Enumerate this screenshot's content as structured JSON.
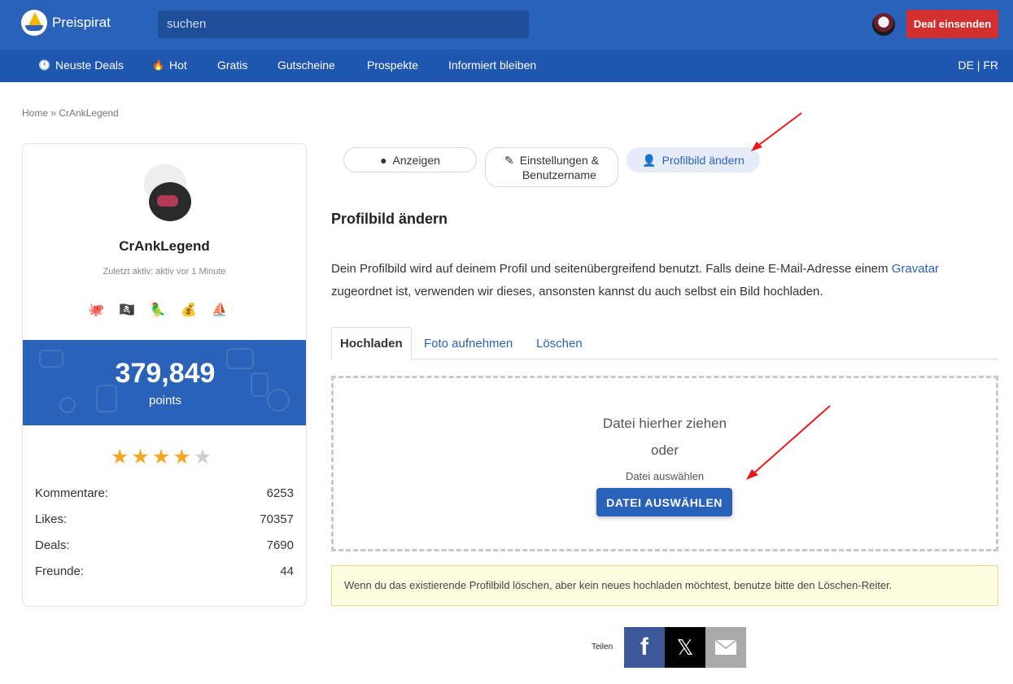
{
  "header": {
    "brand": "Preispirat",
    "search_placeholder": "suchen",
    "deal_button": "Deal einsenden"
  },
  "nav": {
    "items": [
      {
        "label": "Neuste Deals",
        "icon": "clock-icon"
      },
      {
        "label": "Hot",
        "icon": "flame-icon"
      },
      {
        "label": "Gratis"
      },
      {
        "label": "Gutscheine"
      },
      {
        "label": "Prospekte"
      },
      {
        "label": "Informiert bleiben"
      }
    ],
    "lang": "DE | FR"
  },
  "breadcrumb": "Home » CrAnkLegend",
  "profile": {
    "username": "CrAnkLegend",
    "last_active": "Zuletzt aktiv: aktiv vor 1 Minute",
    "points": "379,849",
    "points_label": "points",
    "rating": 4,
    "rating_max": 5,
    "stats": [
      {
        "label": "Kommentare:",
        "value": "6253"
      },
      {
        "label": "Likes:",
        "value": "70357"
      },
      {
        "label": "Deals:",
        "value": "7690"
      },
      {
        "label": "Freunde:",
        "value": "44"
      }
    ]
  },
  "profile_tabs": {
    "show": "Anzeigen",
    "settings_line1": "Einstellungen &",
    "settings_line2": "Benutzername",
    "change_picture": "Profilbild ändern"
  },
  "main": {
    "heading": "Profilbild ändern",
    "desc_part1": "Dein Profilbild wird auf deinem Profil und seitenübergreifend benutzt. Falls deine E-Mail-Adresse einem ",
    "desc_link": "Gravatar",
    "desc_part2": " zugeordnet ist, verwenden wir dieses, ansonsten kannst du auch selbst ein Bild hochladen.",
    "subtabs": [
      "Hochladen",
      "Foto aufnehmen",
      "Löschen"
    ],
    "drop_text": "Datei hierher ziehen",
    "or_text": "oder",
    "choose_hint": "Datei auswählen",
    "choose_button": "DATEI AUSWÄHLEN",
    "notice": "Wenn du das existierende Profilbild löschen, aber kein neues hochladen möchtest, benutze bitte den Löschen-Reiter."
  },
  "share": {
    "label": "Teilen"
  },
  "colors": {
    "primary": "#2a62b9",
    "nav": "#1f57b0",
    "danger": "#d32f2f",
    "star": "#f5a623"
  }
}
